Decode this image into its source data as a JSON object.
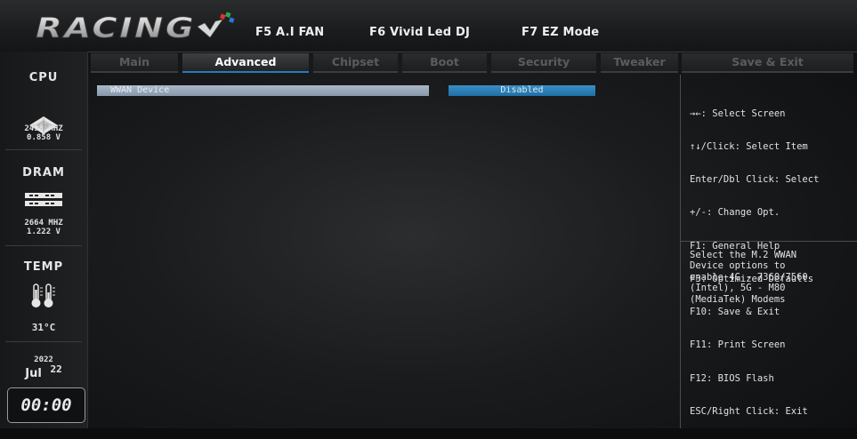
{
  "brand": {
    "name": "RACING"
  },
  "hotkeys": [
    {
      "label": "F5 A.I FAN"
    },
    {
      "label": "F6 Vivid Led DJ"
    },
    {
      "label": "F7 EZ Mode"
    }
  ],
  "sidebar": {
    "cpu": {
      "label": "CPU",
      "freq": "2498 MHZ",
      "volt": "0.858 V"
    },
    "dram": {
      "label": "DRAM",
      "freq": "2664 MHZ",
      "volt": "1.222 V"
    },
    "temp": {
      "label": "TEMP",
      "value": "31°C"
    },
    "date": {
      "year": "2022",
      "month": "Jul",
      "day": "22"
    },
    "time": "00:00"
  },
  "tabs": [
    {
      "label": "Main",
      "active": false
    },
    {
      "label": "Advanced",
      "active": true
    },
    {
      "label": "Chipset",
      "active": false
    },
    {
      "label": "Boot",
      "active": false
    },
    {
      "label": "Security",
      "active": false
    },
    {
      "label": "Tweaker",
      "active": false
    }
  ],
  "save_tab": {
    "label": "Save & Exit"
  },
  "settings": [
    {
      "label": "WWAN Device",
      "value": "Disabled"
    }
  ],
  "help": [
    "→←: Select Screen",
    "↑↓/Click: Select Item",
    "Enter/Dbl Click: Select",
    "+/-: Change Opt.",
    "F1: General Help",
    "F3: Optimized Defaults",
    "F10: Save & Exit",
    "F11: Print Screen",
    "F12: BIOS Flash",
    "ESC/Right Click: Exit"
  ],
  "description": "Select the M.2 WWAN\nDevice options to\nenable 4G - 7360/7560\n(Intel), 5G - M80\n(MediaTek) Modems",
  "colors": {
    "accent": "#2a78c0",
    "selected_row": "#9aaabb",
    "value_box": "#2a80b8"
  }
}
